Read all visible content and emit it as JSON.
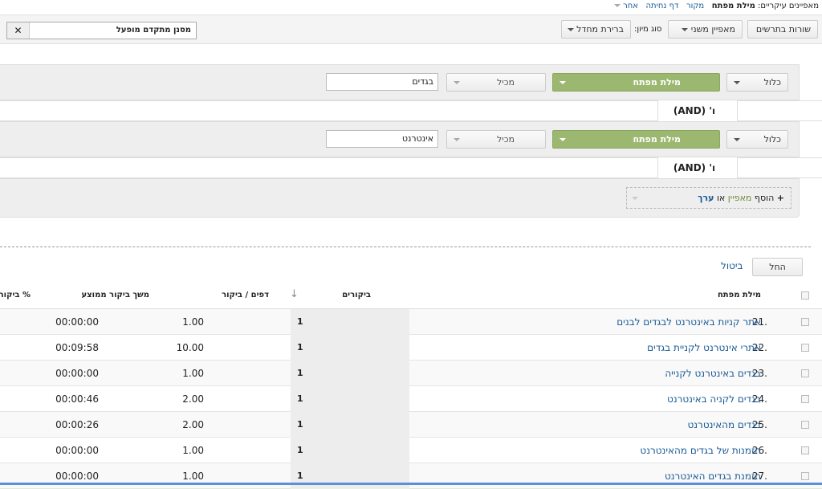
{
  "topnav": {
    "label": "מאפיינים עיקריים:",
    "active": "מילת מפתח",
    "links": [
      "מקור",
      "דף נחיתה"
    ],
    "other": "אחר"
  },
  "toolbar": {
    "plot_rows": "שורות בתרשים",
    "secondary_dimension": "מאפיין משני",
    "sort_label": "סוג מיון:",
    "sort_value": "ברירת מחדל",
    "filter_label": "מסנן מתקדם מופעל",
    "close_icon": "close-icon"
  },
  "filters": [
    {
      "include": "כלול",
      "dimension": "מילת מפתח",
      "match": "מכיל",
      "value": "בגדים"
    },
    {
      "include": "כלול",
      "dimension": "מילת מפתח",
      "match": "מכיל",
      "value": "אינטרנט"
    }
  ],
  "and_label": "ו' (AND)",
  "add": {
    "plus": "+",
    "prefix": "הוסף",
    "dimension": "מאפיין",
    "or": "או",
    "metric": "ערך"
  },
  "actions": {
    "apply": "החל",
    "cancel": "ביטול"
  },
  "table": {
    "headers": {
      "keyword": "מילת מפתח",
      "visits": "ביקורים",
      "pages": "דפים / ביקור",
      "duration": "משך ביקור ממוצע",
      "percent": "% ביקור"
    },
    "rows": [
      {
        "num": "21.",
        "keyword": "אתר קניות באינטרנט לבגדים לבנים",
        "visits": "1",
        "pages": "1.00",
        "duration": "00:00:00"
      },
      {
        "num": "22.",
        "keyword": "אתרי אינטרנט לקניית בגדים",
        "visits": "1",
        "pages": "10.00",
        "duration": "00:09:58"
      },
      {
        "num": "23.",
        "keyword": "בגדים באינטרנט לקנייה",
        "visits": "1",
        "pages": "1.00",
        "duration": "00:00:00"
      },
      {
        "num": "24.",
        "keyword": "בגדים לקניה באינטרנט",
        "visits": "1",
        "pages": "2.00",
        "duration": "00:00:46"
      },
      {
        "num": "25.",
        "keyword": "בגדים מהאינטרנט",
        "visits": "1",
        "pages": "2.00",
        "duration": "00:00:26"
      },
      {
        "num": "26.",
        "keyword": "הזמנות של בגדים מהאינטרנט",
        "visits": "1",
        "pages": "1.00",
        "duration": "00:00:00"
      },
      {
        "num": "27.",
        "keyword": "הזמנת בגדים האינטרנט",
        "visits": "1",
        "pages": "1.00",
        "duration": "00:00:00"
      }
    ]
  }
}
